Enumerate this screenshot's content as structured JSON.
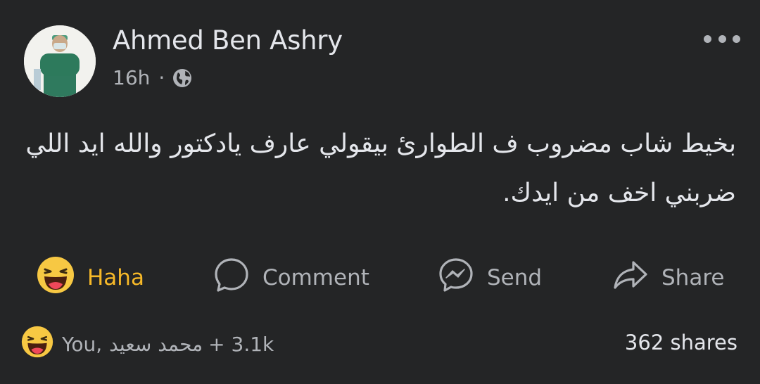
{
  "post": {
    "author": "Ahmed Ben Ashry",
    "time": "16h",
    "separator": "·",
    "privacy_icon": "globe-icon",
    "more_icon": "more-options-icon",
    "text": "بخيط شاب مضروب ف الطوارئ بيقولي عارف يادكتور والله ايد اللي ضربني اخف من ايدك."
  },
  "actions": {
    "haha": {
      "label": "Haha",
      "icon": "haha-emoji-icon",
      "color": "#f7b928"
    },
    "comment": {
      "label": "Comment",
      "icon": "comment-icon"
    },
    "send": {
      "label": "Send",
      "icon": "messenger-icon"
    },
    "share": {
      "label": "Share",
      "icon": "share-icon"
    }
  },
  "reactions_summary": {
    "icon": "haha-emoji-icon",
    "you": "You,",
    "name": "محمد سعيد",
    "more": "+ 3.1k"
  },
  "shares": "362 shares",
  "colors": {
    "background": "#242526",
    "primary_text": "#e4e6eb",
    "secondary_text": "#b0b3b8",
    "haha_yellow": "#f7b928"
  }
}
